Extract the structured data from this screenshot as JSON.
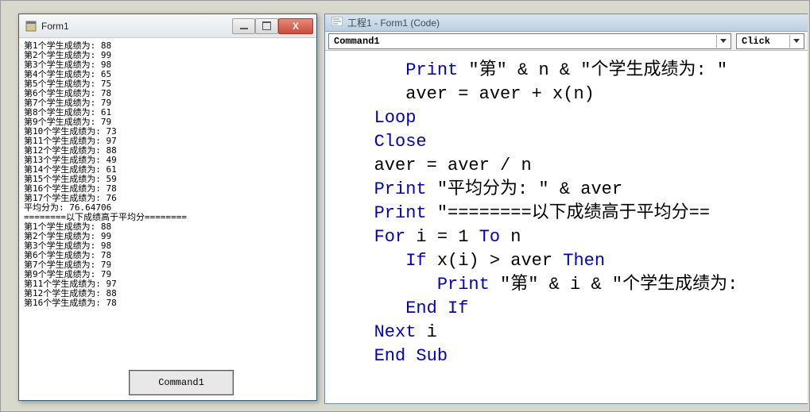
{
  "form1": {
    "title": "Form1",
    "output_lines": [
      "第1个学生成绩为: 88",
      "第2个学生成绩为: 99",
      "第3个学生成绩为: 98",
      "第4个学生成绩为: 65",
      "第5个学生成绩为: 75",
      "第6个学生成绩为: 78",
      "第7个学生成绩为: 79",
      "第8个学生成绩为: 61",
      "第9个学生成绩为: 79",
      "第10个学生成绩为: 73",
      "第11个学生成绩为: 97",
      "第12个学生成绩为: 88",
      "第13个学生成绩为: 49",
      "第14个学生成绩为: 61",
      "第15个学生成绩为: 59",
      "第16个学生成绩为: 78",
      "第17个学生成绩为: 76",
      "平均分为: 76.64706",
      "========以下成绩高于平均分========",
      "第1个学生成绩为: 88",
      "第2个学生成绩为: 99",
      "第3个学生成绩为: 98",
      "第6个学生成绩为: 78",
      "第7个学生成绩为: 79",
      "第9个学生成绩为: 79",
      "第11个学生成绩为: 97",
      "第12个学生成绩为: 88",
      "第16个学生成绩为: 78"
    ],
    "command_button": "Command1"
  },
  "code_window": {
    "title": "工程1 - Form1 (Code)",
    "object_dropdown": "Command1",
    "proc_dropdown": "Click",
    "code_lines": [
      {
        "indent": 2,
        "tokens": [
          {
            "t": "kw",
            "v": "Print"
          },
          {
            "t": "tx",
            "v": " \"第\" & n & \"个学生成绩为: \""
          }
        ]
      },
      {
        "indent": 2,
        "tokens": [
          {
            "t": "tx",
            "v": "aver = aver + x(n)"
          }
        ]
      },
      {
        "indent": 1,
        "tokens": [
          {
            "t": "kw",
            "v": "Loop"
          }
        ]
      },
      {
        "indent": 1,
        "tokens": [
          {
            "t": "kw",
            "v": "Close"
          }
        ]
      },
      {
        "indent": 1,
        "tokens": [
          {
            "t": "tx",
            "v": "aver = aver / n"
          }
        ]
      },
      {
        "indent": 1,
        "tokens": [
          {
            "t": "kw",
            "v": "Print"
          },
          {
            "t": "tx",
            "v": " \"平均分为: \" & aver"
          }
        ]
      },
      {
        "indent": 1,
        "tokens": [
          {
            "t": "kw",
            "v": "Print"
          },
          {
            "t": "tx",
            "v": " \"========以下成绩高于平均分=="
          }
        ]
      },
      {
        "indent": 1,
        "tokens": [
          {
            "t": "kw",
            "v": "For"
          },
          {
            "t": "tx",
            "v": " i = 1 "
          },
          {
            "t": "kw",
            "v": "To"
          },
          {
            "t": "tx",
            "v": " n"
          }
        ]
      },
      {
        "indent": 2,
        "tokens": [
          {
            "t": "kw",
            "v": "If"
          },
          {
            "t": "tx",
            "v": " x(i) > aver "
          },
          {
            "t": "kw",
            "v": "Then"
          }
        ]
      },
      {
        "indent": 3,
        "tokens": [
          {
            "t": "kw",
            "v": "Print"
          },
          {
            "t": "tx",
            "v": " \"第\" & i & \"个学生成绩为:"
          }
        ]
      },
      {
        "indent": 2,
        "tokens": [
          {
            "t": "kw",
            "v": "End If"
          }
        ]
      },
      {
        "indent": 1,
        "tokens": [
          {
            "t": "kw",
            "v": "Next"
          },
          {
            "t": "tx",
            "v": " i"
          }
        ]
      },
      {
        "indent": 1,
        "tokens": [
          {
            "t": "kw",
            "v": "End Sub"
          }
        ]
      }
    ]
  }
}
